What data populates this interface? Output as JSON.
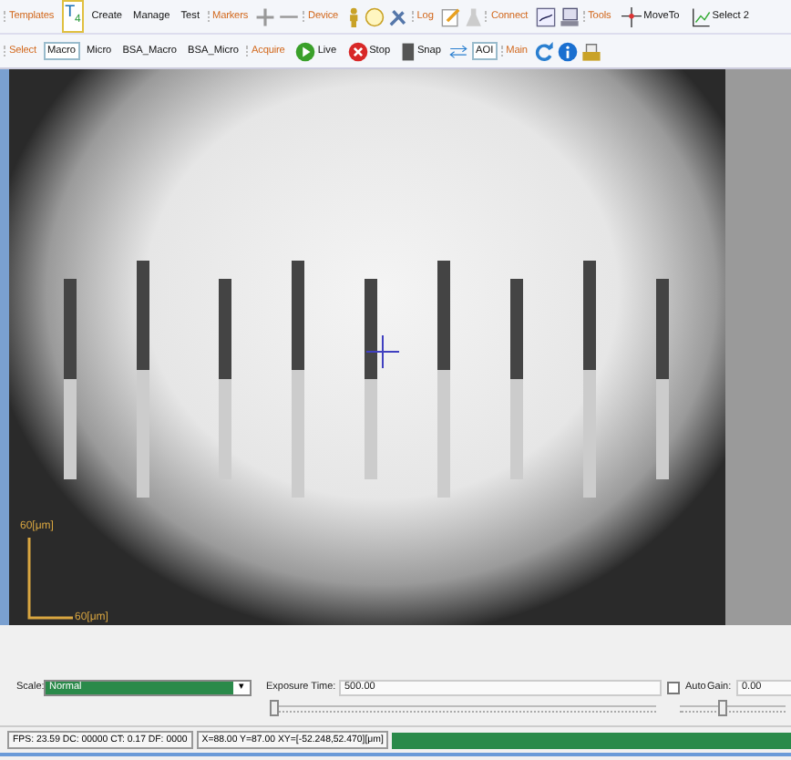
{
  "toolbar_rows": [
    {
      "items": [
        {
          "kind": "group",
          "label": "Templates"
        },
        {
          "kind": "text-icon",
          "label": "T$_{4}$"
        },
        {
          "kind": "button",
          "label": "Create"
        },
        {
          "kind": "button",
          "label": "Manage"
        },
        {
          "kind": "button",
          "label": "Test"
        },
        {
          "kind": "group",
          "label": "Markers"
        },
        {
          "kind": "icon"
        },
        {
          "kind": "icon"
        },
        {
          "kind": "group",
          "label": "Device"
        },
        {
          "kind": "icon"
        },
        {
          "kind": "icon"
        },
        {
          "kind": "icon"
        },
        {
          "kind": "group",
          "label": "Log"
        },
        {
          "kind": "icon"
        },
        {
          "kind": "icon"
        },
        {
          "kind": "group",
          "label": "Connect"
        },
        {
          "kind": "icon"
        },
        {
          "kind": "icon"
        },
        {
          "kind": "group",
          "label": "Tools"
        },
        {
          "kind": "icon-button",
          "label": "MoveTo"
        },
        {
          "kind": "icon-button",
          "label": "Select 2"
        }
      ]
    },
    {
      "items": [
        {
          "kind": "group",
          "label": "Select"
        },
        {
          "kind": "toggle",
          "label": "Macro",
          "selected": true
        },
        {
          "kind": "toggle",
          "label": "Micro",
          "selected": false
        },
        {
          "kind": "toggle",
          "label": "BSA_Macro",
          "selected": false
        },
        {
          "kind": "toggle",
          "label": "BSA_Micro",
          "selected": false
        },
        {
          "kind": "group",
          "label": "Acquire"
        },
        {
          "kind": "icon-button",
          "label": "Live"
        },
        {
          "kind": "icon-button",
          "label": "Stop"
        },
        {
          "kind": "icon-button",
          "label": "Snap"
        },
        {
          "kind": "icon"
        },
        {
          "kind": "toggle",
          "label": "AOI",
          "selected": true
        },
        {
          "kind": "group",
          "label": "Main"
        },
        {
          "kind": "icon"
        },
        {
          "kind": "icon"
        },
        {
          "kind": "icon"
        }
      ]
    }
  ],
  "view": {
    "scale_bar": {
      "vertical_label": "60[μm]",
      "horizontal_label": "60[μm]"
    }
  },
  "controls": {
    "scale_label": "Scale:",
    "scale_value": "Normal",
    "scale_arrow": "▾",
    "exposure_label": "Exposure Time:",
    "exposure_value": "500.00",
    "exposure_slider": {
      "level": 0.0
    },
    "auto": {
      "label": "Auto",
      "checked": false
    },
    "gain_label": "Gain:",
    "gain_value": "0.00",
    "gain_slider": {
      "level": 0.4
    }
  },
  "status_bar": {
    "counters": "FPS: 23.59 DC: 00000 CT: 0.17 DF: 0000",
    "position": "X=88.00 Y=87.00 XY=[-52.248,52.470][μm]",
    "progress": {
      "level": 1
    }
  }
}
